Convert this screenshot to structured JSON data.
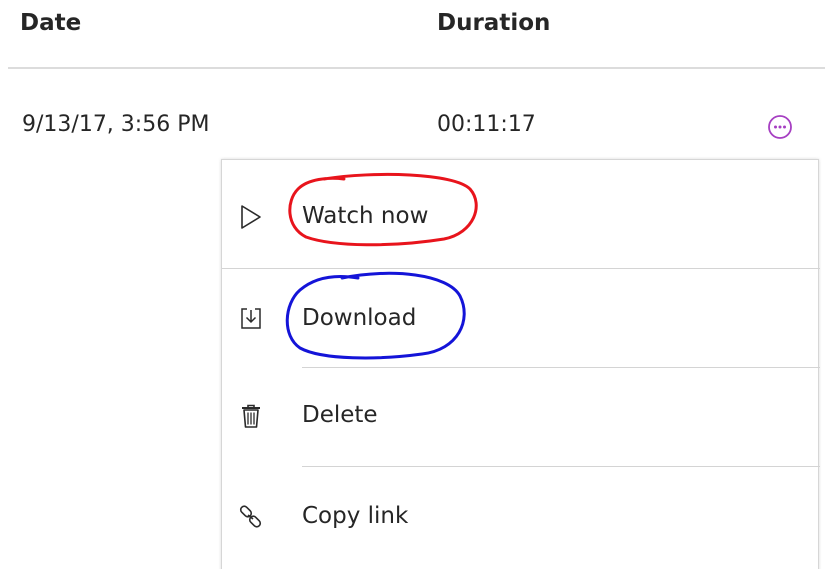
{
  "table": {
    "headers": {
      "date": "Date",
      "duration": "Duration"
    },
    "row": {
      "date": "9/13/17, 3:56 PM",
      "duration": "00:11:17",
      "more_icon": "ellipsis-circle-icon"
    }
  },
  "menu": {
    "items": [
      {
        "label": "Watch now",
        "icon": "play-icon"
      },
      {
        "label": "Download",
        "icon": "download-icon"
      },
      {
        "label": "Delete",
        "icon": "trash-icon"
      },
      {
        "label": "Copy link",
        "icon": "link-icon"
      }
    ]
  },
  "annotations": [
    {
      "target": "Watch now",
      "color": "#e8141c"
    },
    {
      "target": "Download",
      "color": "#1414d8"
    }
  ],
  "colors": {
    "accent": "#a63fc2",
    "text": "#262626"
  }
}
